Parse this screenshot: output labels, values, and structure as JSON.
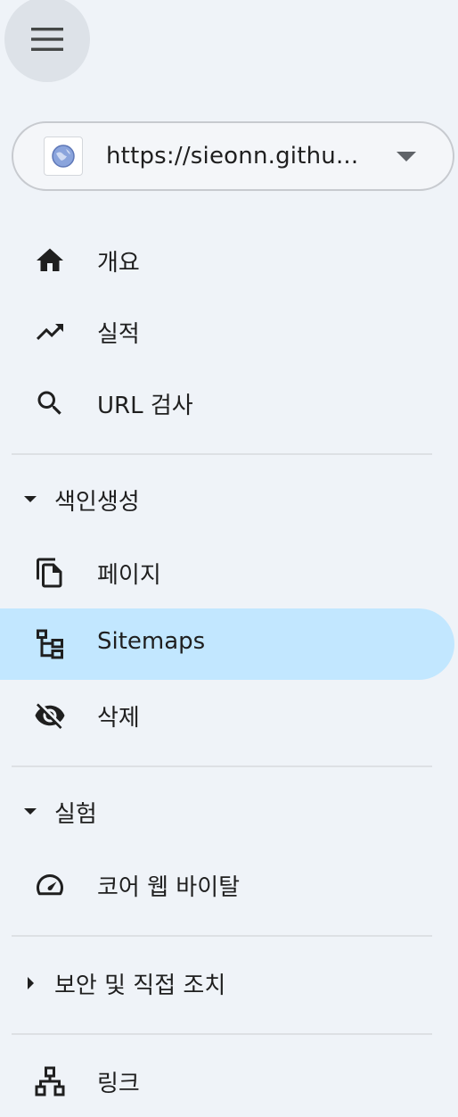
{
  "property": {
    "url": "https://sieonn.githu...",
    "icon": "globe-icon"
  },
  "nav": {
    "overview": {
      "label": "개요",
      "icon": "home-icon"
    },
    "performance": {
      "label": "실적",
      "icon": "trending-up-icon"
    },
    "url_inspection": {
      "label": "URL 검사",
      "icon": "search-icon"
    }
  },
  "indexing": {
    "label": "색인생성",
    "expanded": true,
    "items": {
      "pages": {
        "label": "페이지",
        "icon": "file-copy-icon"
      },
      "sitemaps": {
        "label": "Sitemaps",
        "icon": "sitemap-icon",
        "active": true
      },
      "removals": {
        "label": "삭제",
        "icon": "visibility-off-icon"
      }
    }
  },
  "experience": {
    "label": "실험",
    "expanded": true,
    "items": {
      "core_web_vitals": {
        "label": "코어 웹 바이탈",
        "icon": "speed-gauge-icon"
      }
    }
  },
  "security": {
    "label": "보안 및 직접 조치",
    "expanded": false
  },
  "links": {
    "label": "링크",
    "icon": "link-tree-icon"
  },
  "colors": {
    "background": "#eff3f8",
    "active_bg": "#c2e7ff",
    "icon": "#444746"
  }
}
